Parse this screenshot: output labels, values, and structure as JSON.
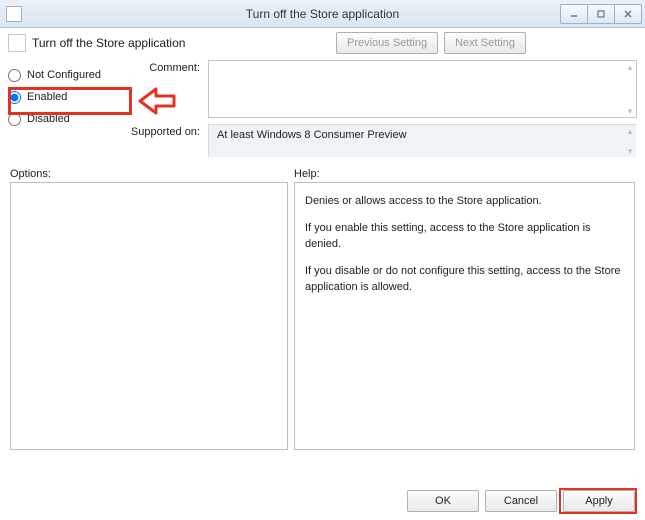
{
  "window": {
    "title": "Turn off the Store application",
    "min": "–",
    "max": "□",
    "close": "X"
  },
  "header": {
    "title": "Turn off the Store application",
    "prev": "Previous Setting",
    "next": "Next Setting"
  },
  "radios": {
    "not_configured": "Not Configured",
    "enabled": "Enabled",
    "disabled": "Disabled",
    "selected": "enabled"
  },
  "labels": {
    "comment": "Comment:",
    "supported": "Supported on:",
    "options": "Options:",
    "help": "Help:"
  },
  "fields": {
    "comment": "",
    "supported": "At least Windows 8 Consumer Preview"
  },
  "help": {
    "p1": "Denies or allows access to the Store application.",
    "p2": "If you enable this setting, access to the Store application is denied.",
    "p3": "If you disable or do not configure this setting, access to the Store application is allowed."
  },
  "footer": {
    "ok": "OK",
    "cancel": "Cancel",
    "apply": "Apply"
  }
}
